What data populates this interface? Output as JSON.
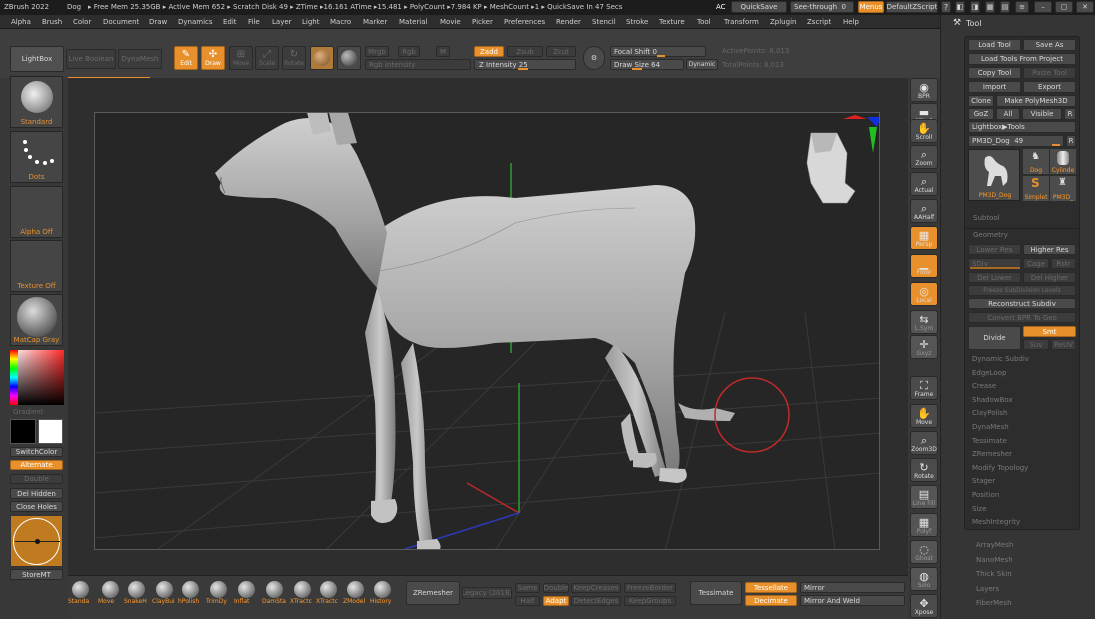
{
  "app": {
    "title": "ZBrush 2022",
    "doc": "Dog",
    "status": "▸ Free Mem 25.35GB ▸ Active Mem 652 ▸ Scratch Disk 49 ▸ ZTime ▸16.161 ATime ▸15.481 ▸ PolyCount ▸7.984 KP ▸ MeshCount ▸1 ▸ QuickSave In 47 Secs"
  },
  "titlebar_right": {
    "ac": "AC",
    "quicksave": "QuickSave",
    "see_through": "See-through",
    "see_through_val": "0",
    "menus": "Menus",
    "script": "DefaultZScript"
  },
  "menus": [
    "Alpha",
    "Brush",
    "Color",
    "Document",
    "Draw",
    "Dynamics",
    "Edit",
    "File",
    "Layer",
    "Light",
    "Macro",
    "Marker",
    "Material",
    "Movie",
    "Picker",
    "Preferences",
    "Render",
    "Stencil",
    "Stroke",
    "Texture",
    "Tool",
    "Transform",
    "Zplugin",
    "Zscript",
    "Help"
  ],
  "toolbar": {
    "lightbox": "LightBox",
    "live_boolean": "Live Boolean",
    "dynamesh": "DynaMesh",
    "edit": "Edit",
    "draw": "Draw",
    "move": "Move",
    "scale": "Scale",
    "rotate": "Rotate",
    "mrgb": "Mrgb",
    "rgb": "Rgb",
    "m": "M",
    "rgb_intensity": "Rgb Intensity",
    "zadd": "Zadd",
    "zsub": "Zsub",
    "zcut": "Zcut",
    "z_intensity_label": "Z Intensity",
    "z_intensity": "25",
    "focal_shift_label": "Focal Shift",
    "focal_shift": "0",
    "draw_size_label": "Draw Size",
    "draw_size": "64",
    "dynamic": "Dynamic",
    "active_points": "ActivePoints: 8,013",
    "total_points": "TotalPoints: 8,013"
  },
  "left": {
    "standard": "Standard",
    "dots": "Dots",
    "alpha_off": "Alpha Off",
    "texture_off": "Texture Off",
    "matcap": "MatCap Gray",
    "gradient": "Gradient",
    "switch_color": "SwitchColor",
    "alternate": "Alternate",
    "double": "Double",
    "del_hidden": "Del Hidden",
    "close_holes": "Close Holes",
    "storemt": "StoreMT"
  },
  "right_shelf": [
    {
      "label": "BPR",
      "icon": "bpr-icon"
    },
    {
      "label": "SPix 3",
      "icon": "spix-icon"
    },
    {
      "label": "Scroll",
      "icon": "hand-icon"
    },
    {
      "label": "Zoom",
      "icon": "zoom-icon"
    },
    {
      "label": "Actual",
      "icon": "actual-icon"
    },
    {
      "label": "AAHalf",
      "icon": "aahalf-icon"
    },
    {
      "label": "Persp",
      "icon": "persp-icon"
    },
    {
      "label": "Floor",
      "icon": "floor-icon"
    },
    {
      "label": "Local",
      "icon": "local-icon"
    },
    {
      "label": "L.Sym",
      "icon": "lsym-icon"
    },
    {
      "label": "Gxyz",
      "icon": "xyz-icon"
    },
    {
      "label": "Frame",
      "icon": "frame-icon"
    },
    {
      "label": "Move",
      "icon": "move-icon"
    },
    {
      "label": "Zoom3D",
      "icon": "zoom3d-icon"
    },
    {
      "label": "Rotate",
      "icon": "rotate-icon"
    },
    {
      "label": "Line Fill",
      "icon": "linefill-icon"
    },
    {
      "label": "Polyf",
      "icon": "polyf-icon"
    },
    {
      "label": "Ghost",
      "icon": "ghost-icon"
    },
    {
      "label": "Solo",
      "icon": "solo-icon"
    },
    {
      "label": "Xpose",
      "icon": "xpose-icon"
    }
  ],
  "tool": {
    "header": "Tool",
    "load_tool": "Load Tool",
    "save_as": "Save As",
    "load_from_project": "Load Tools From Project",
    "copy_tool": "Copy Tool",
    "paste_tool": "Paste Tool",
    "import": "Import",
    "export": "Export",
    "clone": "Clone",
    "make_polymesh": "Make PolyMesh3D",
    "goz": "GoZ",
    "all": "All",
    "visible": "Visible",
    "r": "R",
    "lightbox_tools": "Lightbox▶Tools",
    "current_tool": "PM3D_Dog",
    "current_tool_val": "49",
    "thumbs": [
      "PM3D_Dog",
      "Dog",
      "Cylinde",
      "Simplet",
      "PM3D_"
    ],
    "subtool": "Subtool",
    "geometry": "Geometry",
    "lower_res": "Lower Res",
    "higher_res": "Higher Res",
    "sdiv": "SDiv",
    "cage": "Cage",
    "rstr": "Rstr",
    "del_lower": "Del Lower",
    "del_higher": "Del Higher",
    "freeze": "Freeze SubDivision Levels",
    "reconstruct": "Reconstruct Subdiv",
    "convert_bpr": "Convert BPR To Geo",
    "divide": "Divide",
    "smt": "Smt",
    "suv": "Suv",
    "reuv": "ReUV",
    "sections": [
      "Dynamic Subdiv",
      "EdgeLoop",
      "Crease",
      "ShadowBox",
      "ClayPolish",
      "DynaMesh",
      "Tessimate",
      "ZRemesher",
      "Modify Topology",
      "Stager",
      "Position",
      "Size",
      "MeshIntegrity"
    ],
    "sections2": [
      "ArrayMesh",
      "NanoMesh",
      "Thick Skin",
      "Layers",
      "FiberMesh"
    ]
  },
  "bottom": {
    "brushes": [
      "Standa",
      "Move",
      "SnakeH",
      "ClayBui",
      "hPolish",
      "TrimDy",
      "Inflat",
      "DamSta",
      "XTractc",
      "XTractc",
      "ZModel",
      "History"
    ],
    "zremesher": "ZRemesher",
    "legacy": "Legacy (2018)",
    "same": "Same",
    "double": "Double",
    "half": "Half",
    "adapt": "Adapt",
    "keepcreases": "KeepCreases",
    "detectedges": "DetectEdges",
    "freezeborder": "FreezeBorder",
    "keepgroups": "KeepGroups",
    "tessimate": "Tessimate",
    "tessellate": "Tessellate",
    "decimate": "Decimate",
    "mirror": "Mirror",
    "mirror_weld": "Mirror And Weld"
  }
}
